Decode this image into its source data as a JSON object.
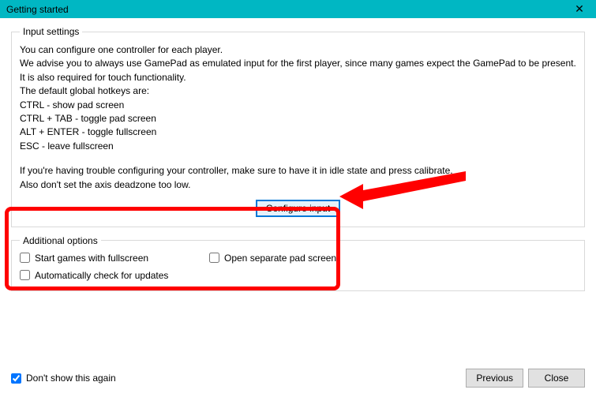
{
  "window": {
    "title": "Getting started",
    "close_glyph": "✕"
  },
  "input_settings": {
    "legend": "Input settings",
    "lines": [
      "You can configure one controller for each player.",
      "We advise you to always use GamePad as emulated input for the first player, since many games expect the GamePad to be present.",
      "It is also required for touch functionality.",
      "The default global hotkeys are:",
      "CTRL - show pad screen",
      "CTRL + TAB - toggle pad screen",
      "ALT + ENTER - toggle fullscreen",
      "ESC - leave fullscreen"
    ],
    "lines2": [
      "If you're having trouble configuring your controller, make sure to have it in idle state and press calibrate.",
      "Also don't set the axis deadzone too low."
    ],
    "configure_button": "Configure input"
  },
  "additional_options": {
    "legend": "Additional options",
    "opt_fullscreen": "Start games with fullscreen",
    "opt_separate_pad": "Open separate pad screen",
    "opt_auto_update": "Automatically check for updates"
  },
  "footer": {
    "dont_show": "Don't show this again",
    "dont_show_checked": true,
    "previous": "Previous",
    "close": "Close"
  }
}
